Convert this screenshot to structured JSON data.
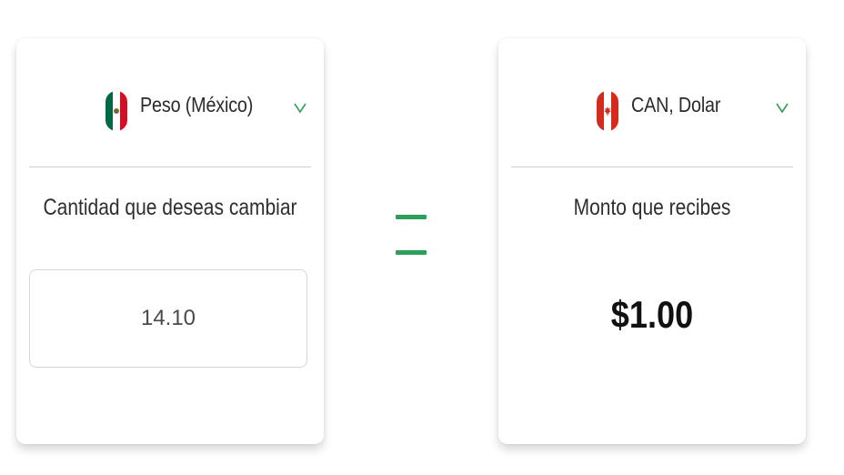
{
  "colors": {
    "accent": "#2e9e5b",
    "text": "#2b2b2b",
    "divider": "#cfcfcf"
  },
  "source": {
    "currency": "Peso (México)",
    "flag_icon": "mexico-flag-icon",
    "section_label": "Cantidad que deseas cambiar",
    "amount_value": "14.10"
  },
  "operator": {
    "icon": "equals-icon"
  },
  "target": {
    "currency": "CAN, Dolar",
    "flag_icon": "canada-flag-icon",
    "section_label": "Monto que recibes",
    "amount_value": "$1.00"
  }
}
